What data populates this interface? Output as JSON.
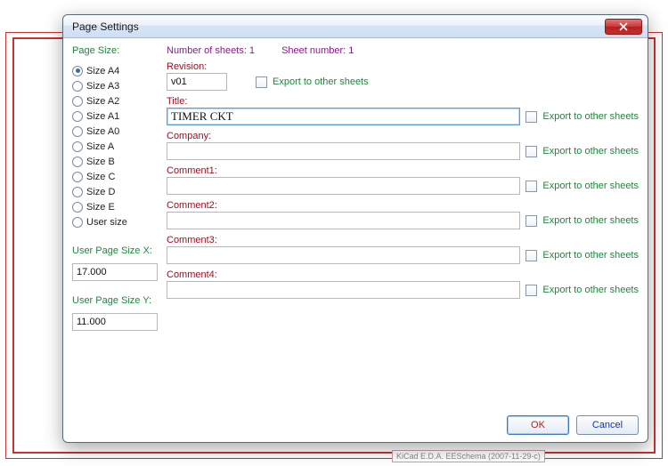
{
  "window": {
    "title": "Page Settings"
  },
  "page_size": {
    "label": "Page Size:",
    "options": [
      {
        "label": "Size A4",
        "selected": true
      },
      {
        "label": "Size A3",
        "selected": false
      },
      {
        "label": "Size A2",
        "selected": false
      },
      {
        "label": "Size A1",
        "selected": false
      },
      {
        "label": "Size A0",
        "selected": false
      },
      {
        "label": "Size A",
        "selected": false
      },
      {
        "label": "Size B",
        "selected": false
      },
      {
        "label": "Size C",
        "selected": false
      },
      {
        "label": "Size D",
        "selected": false
      },
      {
        "label": "Size E",
        "selected": false
      },
      {
        "label": "User size",
        "selected": false
      }
    ]
  },
  "user_x": {
    "label": "User Page Size X:",
    "value": "17.000"
  },
  "user_y": {
    "label": "User Page Size Y:",
    "value": "11.000"
  },
  "info": {
    "sheets_label": "Number of sheets: 1",
    "sheet_num_label": "Sheet number: 1"
  },
  "export_label": "Export to other sheets",
  "fields": {
    "revision": {
      "label": "Revision:",
      "value": "v01"
    },
    "title": {
      "label": "Title:",
      "value": "TIMER CKT"
    },
    "company": {
      "label": "Company:",
      "value": ""
    },
    "comment1": {
      "label": "Comment1:",
      "value": ""
    },
    "comment2": {
      "label": "Comment2:",
      "value": ""
    },
    "comment3": {
      "label": "Comment3:",
      "value": ""
    },
    "comment4": {
      "label": "Comment4:",
      "value": ""
    }
  },
  "buttons": {
    "ok": "OK",
    "cancel": "Cancel"
  },
  "bg_footer": "KiCad E.D.A.   EESchema (2007-11-29-c)"
}
